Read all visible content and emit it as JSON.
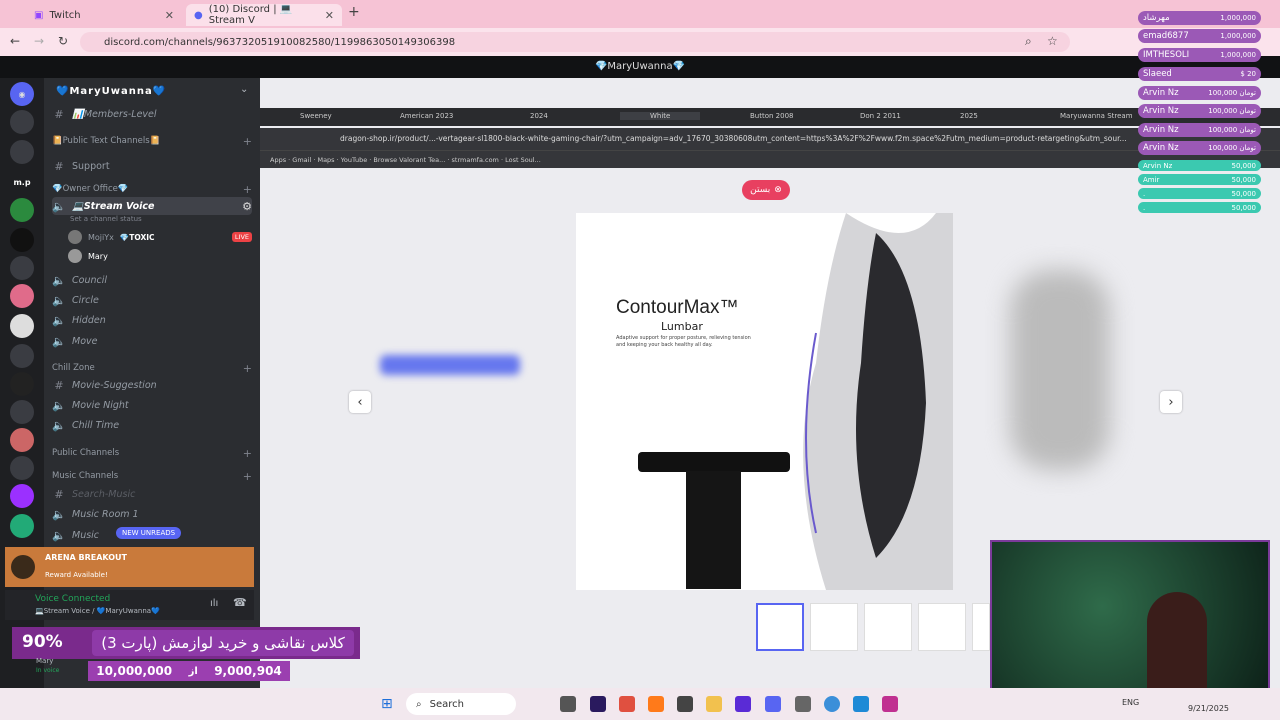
{
  "browser": {
    "tabs": [
      {
        "label": "Twitch",
        "active": false
      },
      {
        "label": "(10) Discord | 💻Stream V",
        "active": true
      }
    ],
    "url": "discord.com/channels/963732051910082580/1199863050149306398"
  },
  "discord": {
    "window_title": "💎MaryUwanna💎",
    "guild_name": "💙MaryUwanna💙",
    "server_labels": [
      "m.p"
    ],
    "channels": [
      {
        "icon": "#",
        "label": "📊Members-Level",
        "type": "text"
      },
      {
        "icon": "",
        "label": "📔Public Text Channels📔",
        "type": "category"
      },
      {
        "icon": "#",
        "label": "Support",
        "type": "text"
      },
      {
        "icon": "",
        "label": "💎Owner Office💎",
        "type": "category"
      },
      {
        "icon": "🔊",
        "label": "💻Stream Voice",
        "type": "voice",
        "active": true,
        "status": "Set a channel status"
      },
      {
        "icon": "",
        "label": "MojiYx",
        "type": "user",
        "badge": "💎TOXIC",
        "live": "LIVE"
      },
      {
        "icon": "",
        "label": "Mary",
        "type": "user"
      },
      {
        "icon": "🔊",
        "label": "Council",
        "type": "voice"
      },
      {
        "icon": "🔊",
        "label": "Circle",
        "type": "voice"
      },
      {
        "icon": "🔊",
        "label": "Hidden",
        "type": "voice"
      },
      {
        "icon": "🔊",
        "label": "Move",
        "type": "voice"
      },
      {
        "icon": "",
        "label": "Chill Zone",
        "type": "category"
      },
      {
        "icon": "#",
        "label": "Movie-Suggestion",
        "type": "text"
      },
      {
        "icon": "🔊",
        "label": "Movie Night",
        "type": "voice"
      },
      {
        "icon": "🔊",
        "label": "Chill Time",
        "type": "voice"
      },
      {
        "icon": "",
        "label": "Public Channels",
        "type": "category"
      },
      {
        "icon": "",
        "label": "Music Channels",
        "type": "category"
      },
      {
        "icon": "#",
        "label": "Search-Music",
        "type": "text"
      },
      {
        "icon": "🔊",
        "label": "Music Room 1",
        "type": "voice"
      },
      {
        "icon": "🔊",
        "label": "Music",
        "type": "voice"
      }
    ],
    "new_unreads": "NEW UNREADS",
    "arena": {
      "title": "ARENA BREAKOUT",
      "subtitle": "Reward Available!"
    },
    "voice": {
      "status": "Voice Connected",
      "detail": "💻Stream Voice / 💙MaryUwanna💙"
    },
    "user": {
      "name": "Mary",
      "status": "In voice"
    }
  },
  "stream": {
    "inner_tabs": [
      "Sweeney",
      "...",
      "American 2023",
      "2024",
      "White",
      "Button 2008",
      "Don 2 2011",
      "2025",
      "Maryuwanna Stream"
    ],
    "inner_url": "dragon-shop.ir/product/...-vertagear-sl1800-black-white-gaming-chair/?utm_campaign=adv_17670_30380608utm_content=https%3A%2F%2Fwww.f2m.space%2Futm_medium=product-retargeting&utm_sour...",
    "bookmarks": [
      "Apps",
      "Gmail",
      "Maps",
      "YouTube",
      "Browse Valorant Tea...",
      "strmamfa.com",
      "Lost Soul..."
    ],
    "close_label": "بستن",
    "product": {
      "title": "ContourMax™",
      "subtitle": "Lumbar",
      "desc": "Adaptive support for proper posture, relieving tension and keeping your back healthy all day."
    }
  },
  "overlay": {
    "donors": [
      {
        "name": "مهرشاد",
        "amount": "1,000,000",
        "color": "#9b59b6"
      },
      {
        "name": "emad6877",
        "amount": "1,000,000",
        "color": "#9b59b6"
      },
      {
        "name": "IMTHESOLI",
        "amount": "1,000,000",
        "color": "#9b59b6"
      },
      {
        "name": "Slaeed",
        "amount": "$ 20",
        "color": "#9b59b6"
      },
      {
        "name": "Arvin Nz",
        "amount": "100,000 تومان",
        "color": "#9b59b6"
      },
      {
        "name": "Arvin Nz",
        "amount": "100,000 تومان",
        "color": "#9b59b6"
      },
      {
        "name": "Arvin Nz",
        "amount": "100,000 تومان",
        "color": "#9b59b6"
      },
      {
        "name": "Arvin Nz",
        "amount": "100,000 تومان",
        "color": "#9b59b6"
      },
      {
        "name": "Arvin Nz",
        "amount": "50,000",
        "color": "#3bc9b0"
      },
      {
        "name": "Amir",
        "amount": "50,000",
        "color": "#3bc9b0"
      },
      {
        "name": ".",
        "amount": "50,000",
        "color": "#3bc9b0"
      },
      {
        "name": ".",
        "amount": "50,000",
        "color": "#3bc9b0"
      }
    ],
    "promo": {
      "percent": "90%",
      "title": "کلاس نقاشی و خرید لوازمش (پارت 3)",
      "target": "10,000,000",
      "from_word": "از",
      "current": "9,000,904"
    }
  },
  "taskbar": {
    "search": "Search",
    "lang": "ENG",
    "date": "9/21/2025"
  }
}
